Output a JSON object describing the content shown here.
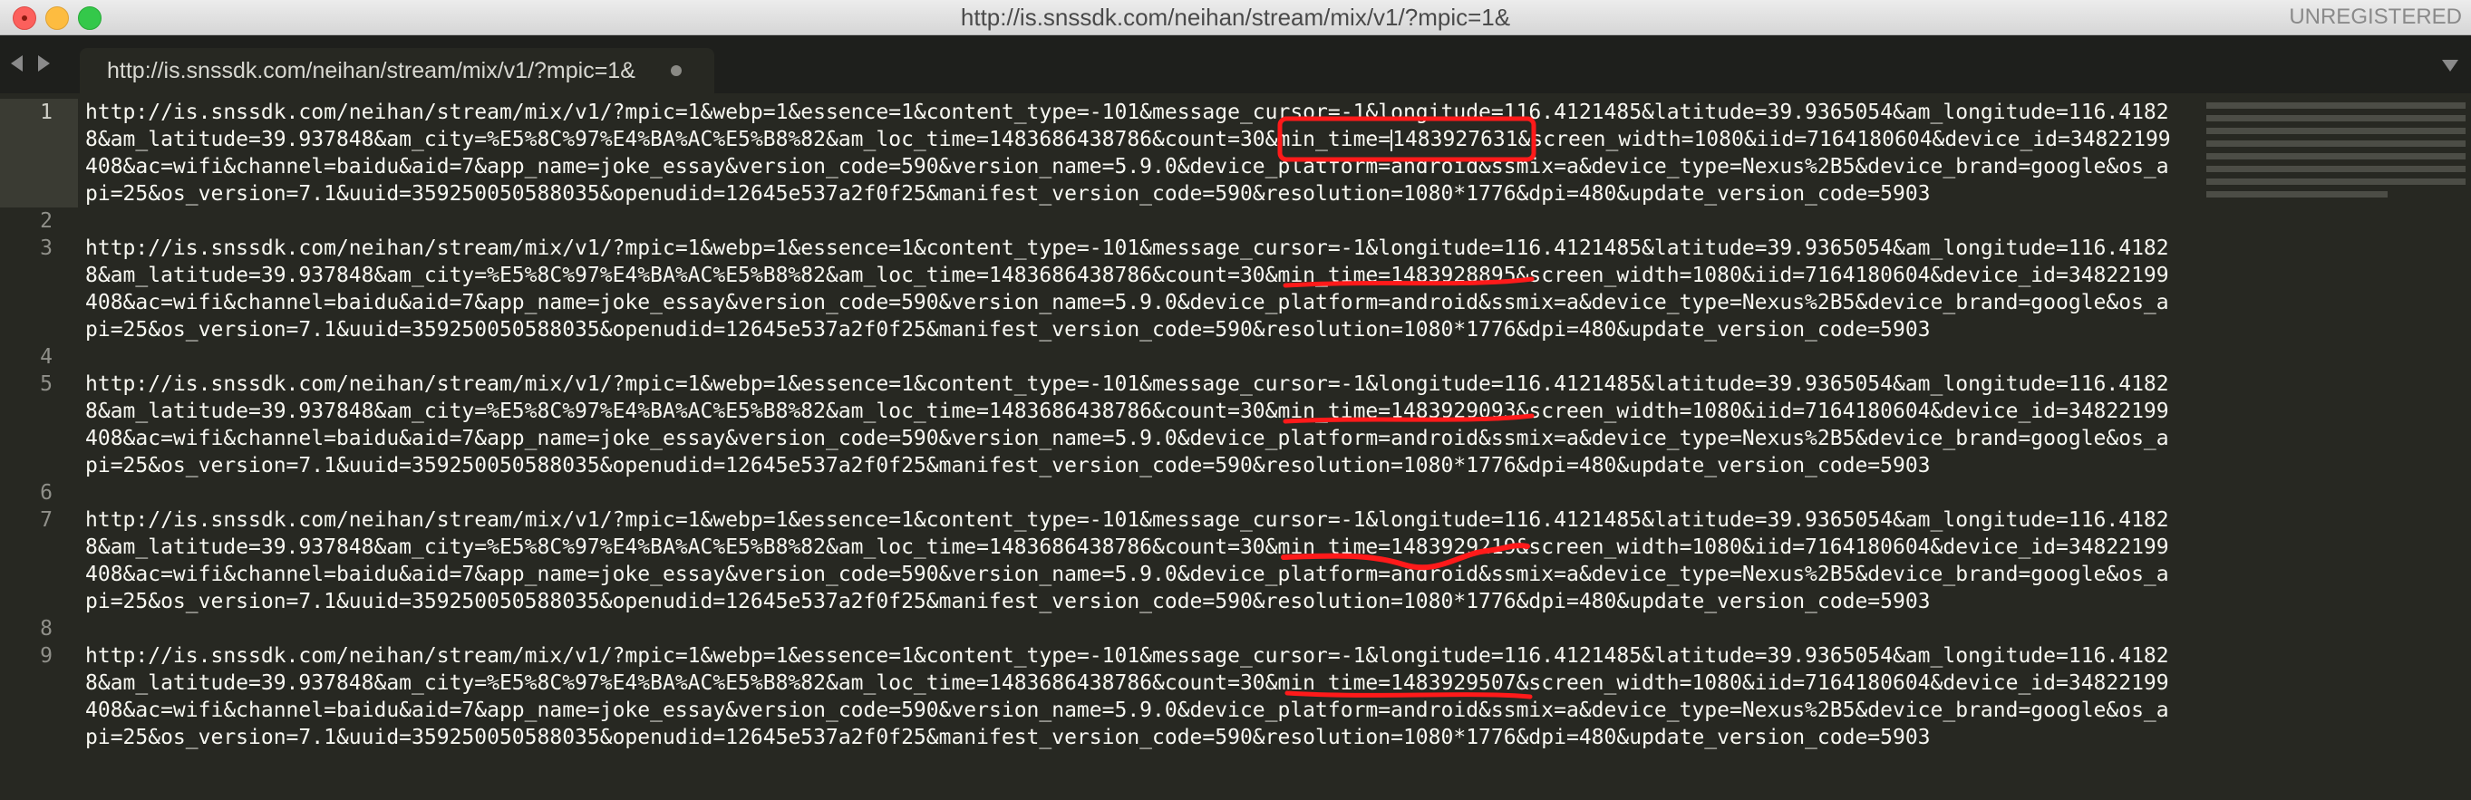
{
  "window": {
    "title": "http://is.snssdk.com/neihan/stream/mix/v1/?mpic=1&",
    "status": "UNREGISTERED"
  },
  "tab": {
    "label": "http://is.snssdk.com/neihan/stream/mix/v1/?mpic=1&"
  },
  "icons": {
    "close": "close-icon",
    "minimize": "minimize-icon",
    "zoom": "zoom-icon",
    "nav_back": "chevron-left-icon",
    "nav_forward": "chevron-right-icon",
    "tab_dirty": "dot-icon",
    "tab_menu": "chevron-down-icon"
  },
  "colors": {
    "editor_bg": "#272822",
    "text": "#f8f8f2",
    "annotation": "#ff1a1a"
  },
  "line_numbers": [
    "1",
    "2",
    "3",
    "4",
    "5",
    "6",
    "7",
    "8",
    "9"
  ],
  "lines": [
    {
      "number": "1",
      "rows": [
        "http://is.snssdk.com/neihan/stream/mix/v1/?mpic=1&webp=1&essence=1&content_type=-101&message_cursor=-1&longitude=116.4121485&latitude=39.9365054&am_longitude=116.4182",
        "8&am_latitude=39.937848&am_city=%E5%8C%97%E4%BA%AC%E5%B8%82&am_loc_time=1483686438786&count=30&min_time=",
        "408&ac=wifi&channel=baidu&aid=7&app_name=joke_essay&version_code=590&version_name=5.9.0&device_platform=android&ssmix=a&device_type=Nexus%2B5&device_brand=google&os_a",
        "pi=25&os_version=7.1&uuid=359250050588035&openudid=12645e537a2f0f25&manifest_version_code=590&resolution=1080*1776&dpi=480&update_version_code=5903"
      ],
      "after_caret": "1483927631&screen_width=1080&iid=7164180604&device_id=34822199"
    },
    {
      "number": "3",
      "rows": [
        "http://is.snssdk.com/neihan/stream/mix/v1/?mpic=1&webp=1&essence=1&content_type=-101&message_cursor=-1&longitude=116.4121485&latitude=39.9365054&am_longitude=116.4182",
        "8&am_latitude=39.937848&am_city=%E5%8C%97%E4%BA%AC%E5%B8%82&am_loc_time=1483686438786&count=30&min_time=1483928895&screen_width=1080&iid=7164180604&device_id=34822199",
        "408&ac=wifi&channel=baidu&aid=7&app_name=joke_essay&version_code=590&version_name=5.9.0&device_platform=android&ssmix=a&device_type=Nexus%2B5&device_brand=google&os_a",
        "pi=25&os_version=7.1&uuid=359250050588035&openudid=12645e537a2f0f25&manifest_version_code=590&resolution=1080*1776&dpi=480&update_version_code=5903"
      ]
    },
    {
      "number": "5",
      "rows": [
        "http://is.snssdk.com/neihan/stream/mix/v1/?mpic=1&webp=1&essence=1&content_type=-101&message_cursor=-1&longitude=116.4121485&latitude=39.9365054&am_longitude=116.4182",
        "8&am_latitude=39.937848&am_city=%E5%8C%97%E4%BA%AC%E5%B8%82&am_loc_time=1483686438786&count=30&min_time=1483929093&screen_width=1080&iid=7164180604&device_id=34822199",
        "408&ac=wifi&channel=baidu&aid=7&app_name=joke_essay&version_code=590&version_name=5.9.0&device_platform=android&ssmix=a&device_type=Nexus%2B5&device_brand=google&os_a",
        "pi=25&os_version=7.1&uuid=359250050588035&openudid=12645e537a2f0f25&manifest_version_code=590&resolution=1080*1776&dpi=480&update_version_code=5903"
      ]
    },
    {
      "number": "7",
      "rows": [
        "http://is.snssdk.com/neihan/stream/mix/v1/?mpic=1&webp=1&essence=1&content_type=-101&message_cursor=-1&longitude=116.4121485&latitude=39.9365054&am_longitude=116.4182",
        "8&am_latitude=39.937848&am_city=%E5%8C%97%E4%BA%AC%E5%B8%82&am_loc_time=1483686438786&count=30&min_time=1483929219&screen_width=1080&iid=7164180604&device_id=34822199",
        "408&ac=wifi&channel=baidu&aid=7&app_name=joke_essay&version_code=590&version_name=5.9.0&device_platform=android&ssmix=a&device_type=Nexus%2B5&device_brand=google&os_a",
        "pi=25&os_version=7.1&uuid=359250050588035&openudid=12645e537a2f0f25&manifest_version_code=590&resolution=1080*1776&dpi=480&update_version_code=5903"
      ]
    },
    {
      "number": "9",
      "rows": [
        "http://is.snssdk.com/neihan/stream/mix/v1/?mpic=1&webp=1&essence=1&content_type=-101&message_cursor=-1&longitude=116.4121485&latitude=39.9365054&am_longitude=116.4182",
        "8&am_latitude=39.937848&am_city=%E5%8C%97%E4%BA%AC%E5%B8%82&am_loc_time=1483686438786&count=30&min_time=1483929507&screen_width=1080&iid=7164180604&device_id=34822199",
        "408&ac=wifi&channel=baidu&aid=7&app_name=joke_essay&version_code=590&version_name=5.9.0&device_platform=android&ssmix=a&device_type=Nexus%2B5&device_brand=google&os_a",
        "pi=25&os_version=7.1&uuid=359250050588035&openudid=12645e537a2f0f25&manifest_version_code=590&resolution=1080*1776&dpi=480&update_version_code=5903"
      ]
    }
  ]
}
